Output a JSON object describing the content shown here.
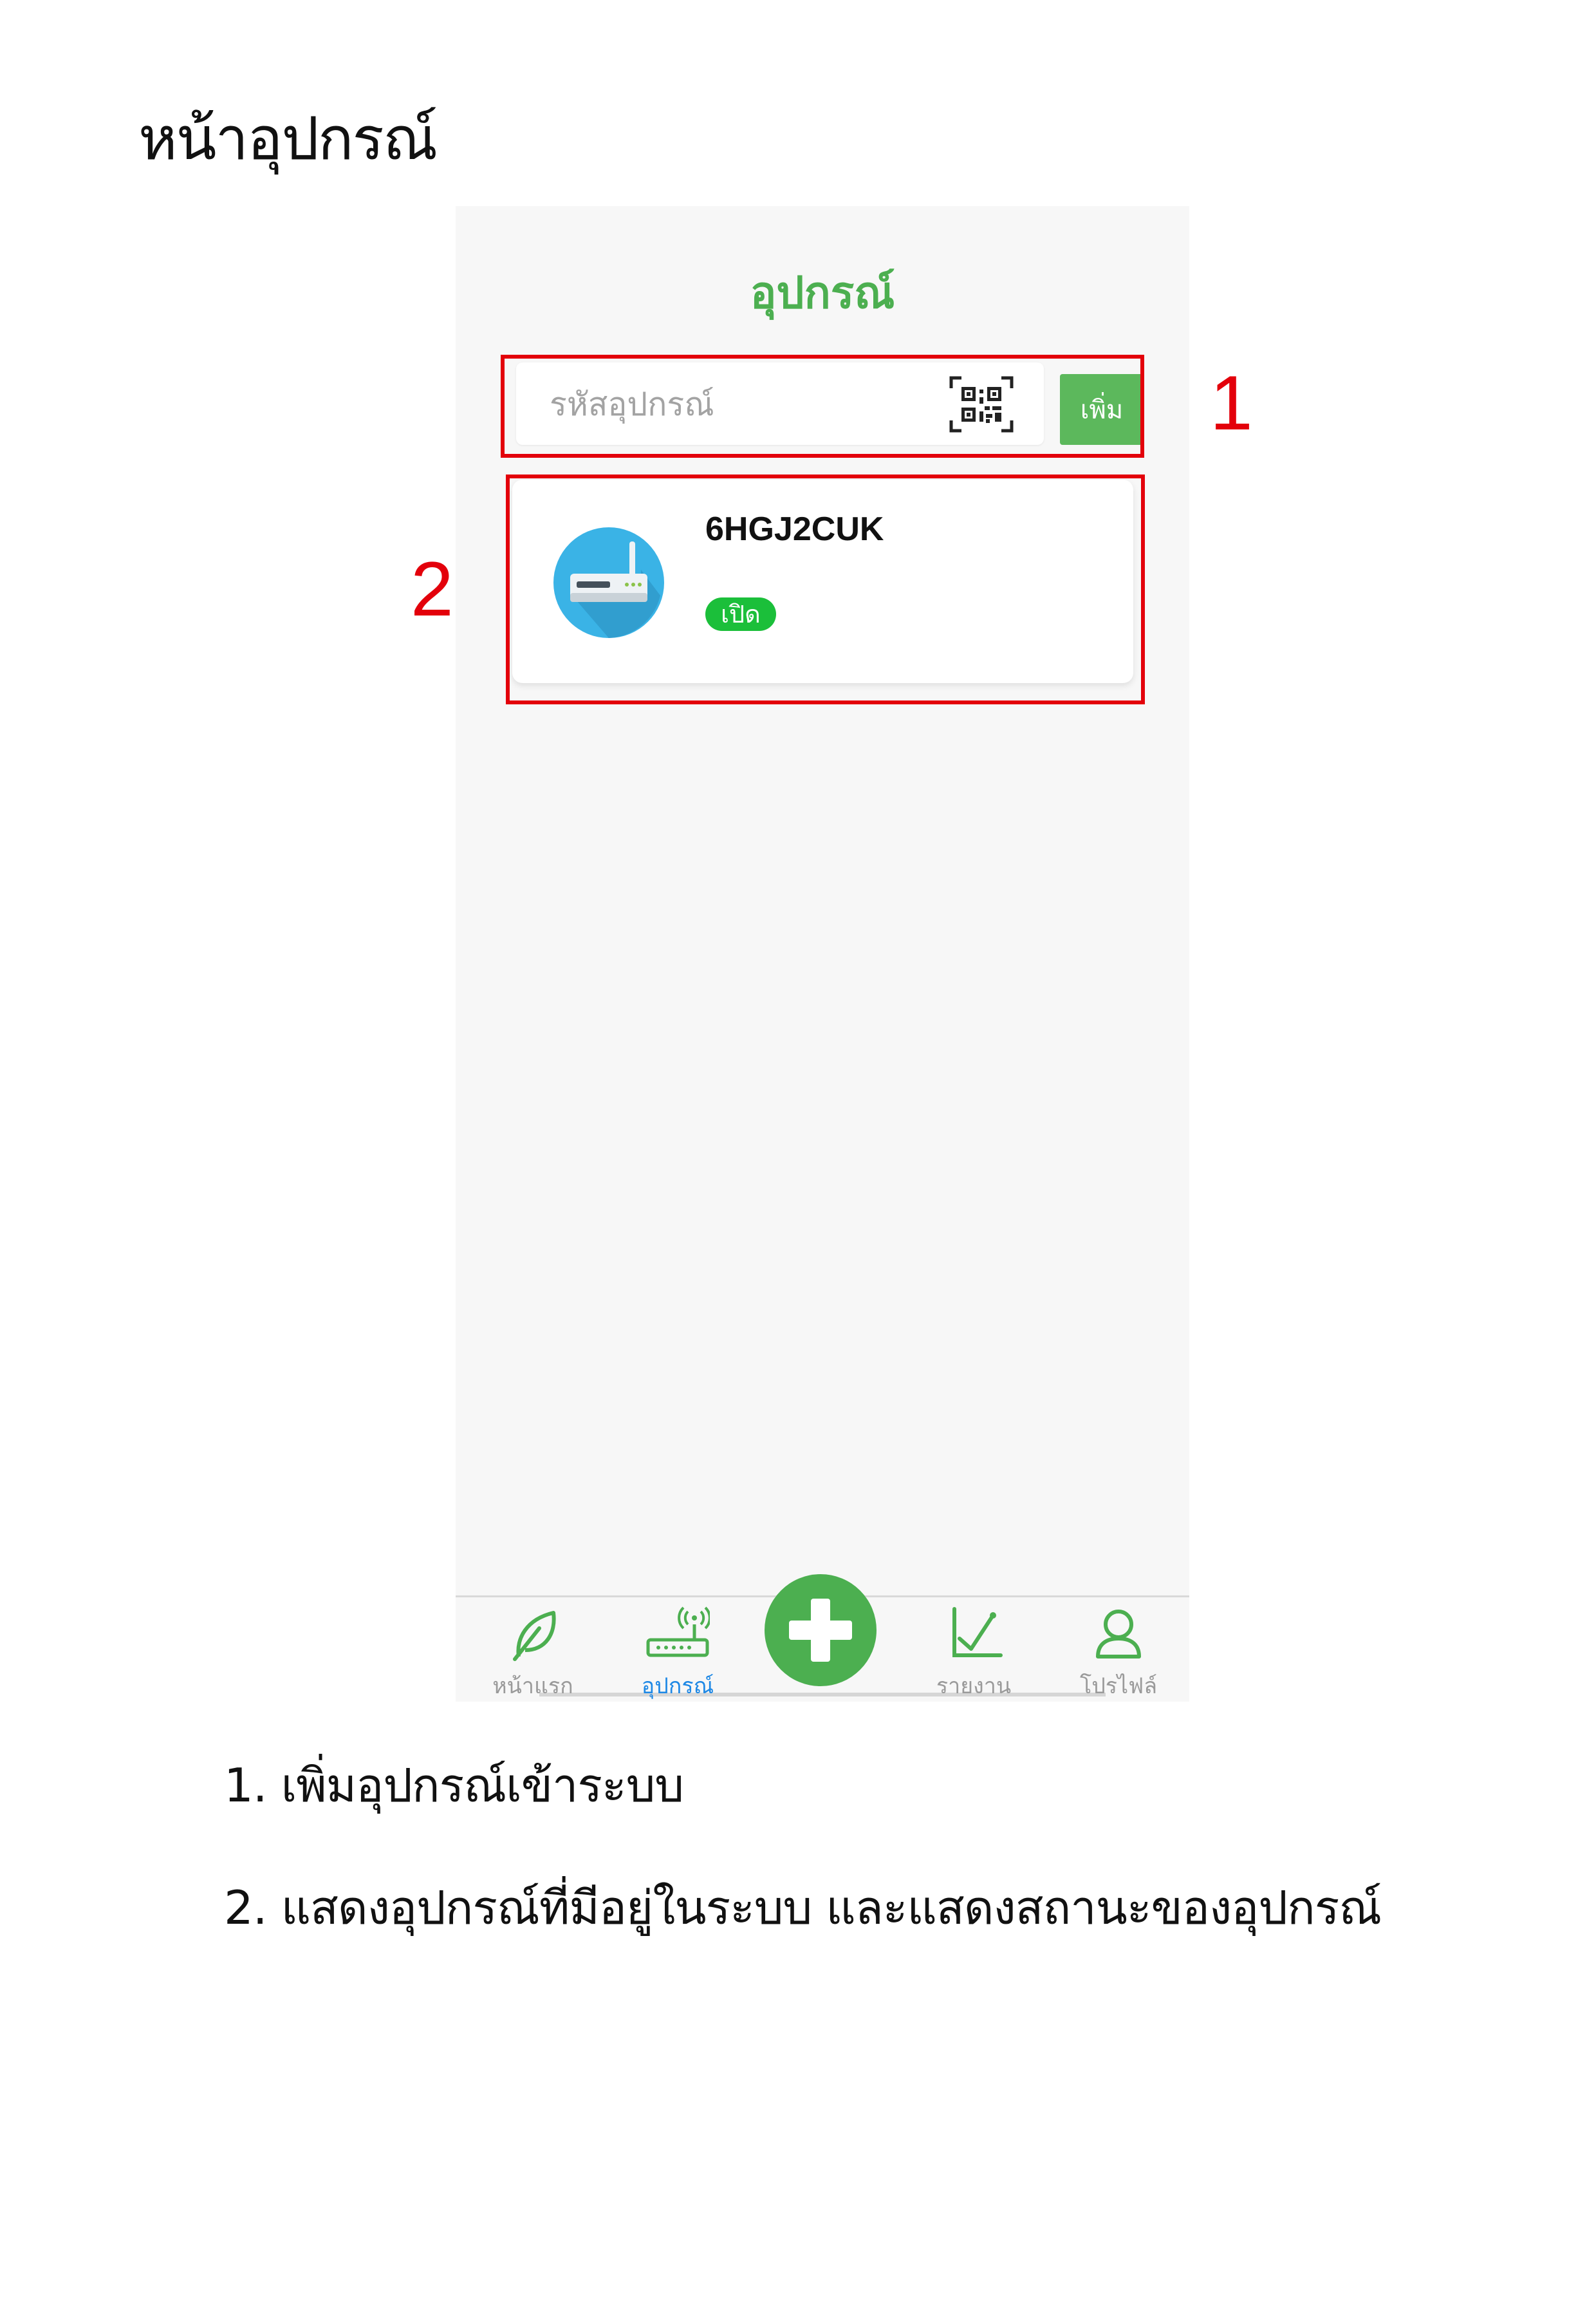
{
  "page_heading": "หน้าอุปกรณ์",
  "app": {
    "title": "อุปกรณ์",
    "search": {
      "placeholder": "รหัสอุปกรณ์",
      "value": "",
      "qr_icon": "qr-code-icon",
      "add_label": "เพิ่ม"
    },
    "device": {
      "code": "6HGJ2CUK",
      "status": "เปิด",
      "icon": "router-icon"
    },
    "nav": [
      {
        "label": "หน้าแรก",
        "icon": "leaf-icon",
        "active": false
      },
      {
        "label": "อุปกรณ์",
        "icon": "router-icon",
        "active": true
      },
      {
        "label": "รายงาน",
        "icon": "chart-icon",
        "active": false
      },
      {
        "label": "โปรไฟล์",
        "icon": "user-icon",
        "active": false
      }
    ],
    "fab_icon": "plus-icon"
  },
  "annotations": {
    "marker_1": "1",
    "marker_2": "2"
  },
  "captions": {
    "item_1": "1. เพิ่มอุปกรณ์เข้าระบบ",
    "item_2": "2. แสดงอุปกรณ์ที่มีอยู่ในระบบ และแสดงสถานะของอุปกรณ์"
  },
  "colors": {
    "brand_green": "#4caf50",
    "button_green": "#5cb85c",
    "status_green": "#1bbf3a",
    "annotation_red": "#e3000b",
    "nav_active": "#1e88e5",
    "device_icon_blue": "#3ab3e6"
  }
}
